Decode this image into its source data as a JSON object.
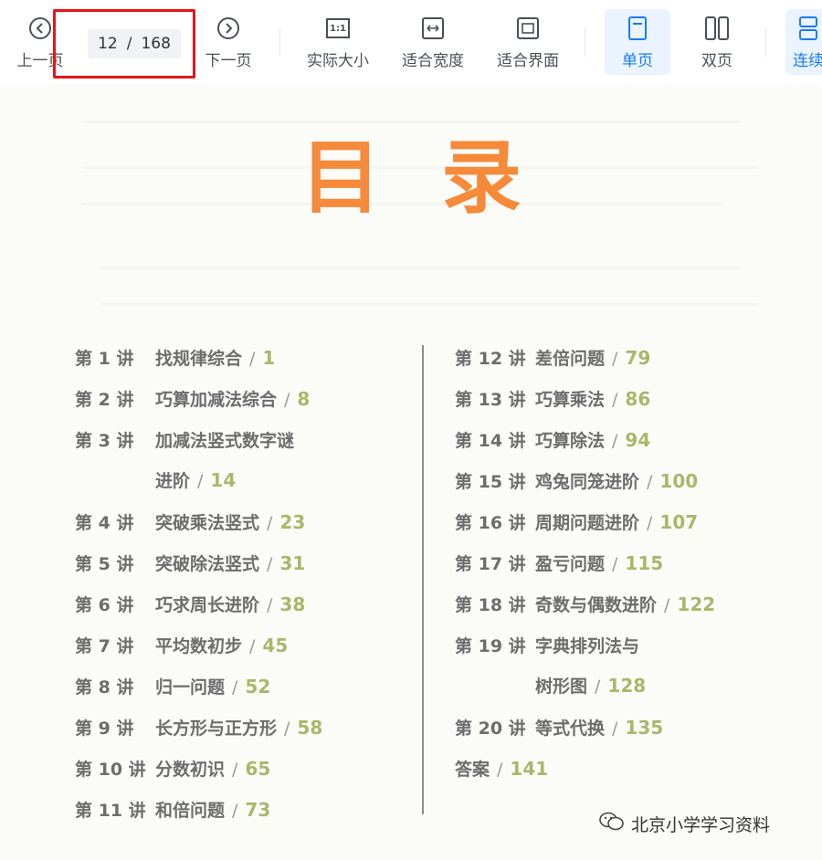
{
  "toolbar": {
    "prev_label": "上一页",
    "next_label": "下一页",
    "page_current": "12",
    "page_total": "168",
    "page_separator": "/",
    "actual_size_label": "实际大小",
    "actual_size_icon_text": "1:1",
    "fit_width_label": "适合宽度",
    "fit_page_label": "适合界面",
    "single_page_label": "单页",
    "double_page_label": "双页",
    "continuous_label": "连续",
    "icons": {
      "prev": "chevron-left-circle-icon",
      "next": "chevron-right-circle-icon",
      "actual_size": "one-to-one-icon",
      "fit_width": "fit-width-icon",
      "fit_page": "fit-page-icon",
      "single": "single-page-icon",
      "double": "double-page-icon",
      "continuous": "continuous-page-icon"
    },
    "active_mode": "single",
    "accent_color": "#1a7cf0"
  },
  "document": {
    "title": "目录",
    "title_color": "#f58a3a",
    "page_number_color": "#a8b86a",
    "left_column": [
      {
        "num": "第 1 讲",
        "title": "找规律综合",
        "page": "1"
      },
      {
        "num": "第 2 讲",
        "title": "巧算加减法综合",
        "page": "8"
      },
      {
        "num": "第 3 讲",
        "title": "加减法竖式数字谜",
        "cont": "进阶",
        "page": "14"
      },
      {
        "num": "第 4 讲",
        "title": "突破乘法竖式",
        "page": "23"
      },
      {
        "num": "第 5 讲",
        "title": "突破除法竖式",
        "page": "31"
      },
      {
        "num": "第 6 讲",
        "title": "巧求周长进阶",
        "page": "38"
      },
      {
        "num": "第 7 讲",
        "title": "平均数初步",
        "page": "45"
      },
      {
        "num": "第 8 讲",
        "title": "归一问题",
        "page": "52"
      },
      {
        "num": "第 9 讲",
        "title": "长方形与正方形",
        "page": "58"
      },
      {
        "num": "第 10 讲",
        "title": "分数初识",
        "page": "65"
      },
      {
        "num": "第 11 讲",
        "title": "和倍问题",
        "page": "73"
      }
    ],
    "right_column": [
      {
        "num": "第 12 讲",
        "title": "差倍问题",
        "page": "79"
      },
      {
        "num": "第 13 讲",
        "title": "巧算乘法",
        "page": "86"
      },
      {
        "num": "第 14 讲",
        "title": "巧算除法",
        "page": "94"
      },
      {
        "num": "第 15 讲",
        "title": "鸡兔同笼进阶",
        "page": "100"
      },
      {
        "num": "第 16 讲",
        "title": "周期问题进阶",
        "page": "107"
      },
      {
        "num": "第 17 讲",
        "title": "盈亏问题",
        "page": "115"
      },
      {
        "num": "第 18 讲",
        "title": "奇数与偶数进阶",
        "page": "122"
      },
      {
        "num": "第 19 讲",
        "title": "字典排列法与",
        "cont": "树形图",
        "page": "128"
      },
      {
        "num": "第 20 讲",
        "title": "等式代换",
        "page": "135"
      },
      {
        "num": "答案",
        "title": "",
        "page": "141"
      }
    ],
    "slash": "/",
    "watermark": "北京小学学习资料",
    "watermark_icon": "wechat-icon"
  }
}
